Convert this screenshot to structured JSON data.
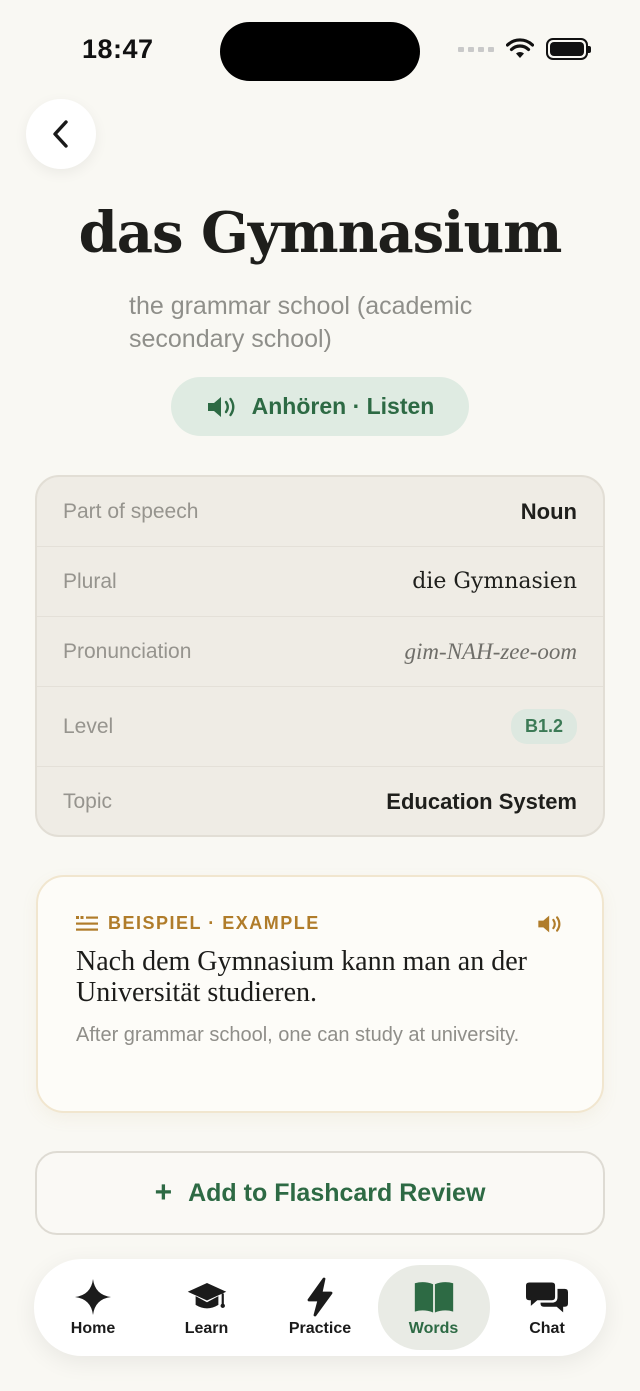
{
  "status": {
    "time": "18:47"
  },
  "word": {
    "title": "das Gymnasium",
    "translation": "the grammar school (academic secondary school)",
    "listen_label": "Anhören · Listen"
  },
  "details": {
    "rows": [
      {
        "label": "Part of speech",
        "value": "Noun"
      },
      {
        "label": "Plural",
        "value": "die Gymnasien"
      },
      {
        "label": "Pronunciation",
        "value": "gim-NAH-zee-oom"
      },
      {
        "label": "Level",
        "value": "B1.2"
      },
      {
        "label": "Topic",
        "value": "Education System"
      }
    ]
  },
  "example": {
    "tag": "BEISPIEL · EXAMPLE",
    "sentence": "Nach dem Gymnasium kann man an der Universität studieren.",
    "translation": "After grammar school, one can study at university."
  },
  "actions": {
    "add_label": "Add to Flashcard Review",
    "add_symbol": "+"
  },
  "tabs": [
    {
      "label": "Home",
      "icon": "sparkle-icon"
    },
    {
      "label": "Learn",
      "icon": "graduation-cap-icon"
    },
    {
      "label": "Practice",
      "icon": "lightning-icon"
    },
    {
      "label": "Words",
      "icon": "open-book-icon",
      "active": true
    },
    {
      "label": "Chat",
      "icon": "chat-bubbles-icon"
    }
  ],
  "colors": {
    "accent": "#2d6a44",
    "example_accent": "#b07c2a",
    "background": "#f9f8f3"
  }
}
